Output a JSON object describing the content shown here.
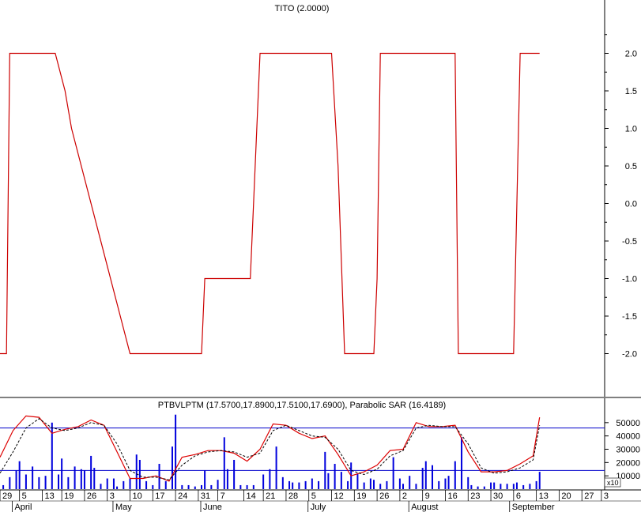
{
  "chart_data": [
    {
      "type": "line",
      "title": "TITO (2.0000)",
      "ylim": [
        -2.5,
        2.5
      ],
      "yticks": [
        "2.0",
        "1.5",
        "1.0",
        "0.5",
        "0.0",
        "-0.5",
        "-1.0",
        "-1.5",
        "-2.0"
      ],
      "ytick_values": [
        2.0,
        1.5,
        1.0,
        0.5,
        0.0,
        -0.5,
        -1.0,
        -1.5,
        -2.0
      ],
      "grid": false,
      "line_color": "#cc0000",
      "series": [
        {
          "x": [
            0,
            2,
            3,
            17,
            20,
            22,
            40,
            42,
            43,
            44,
            60,
            62,
            63,
            64,
            76,
            77,
            80,
            82,
            83,
            101,
            102,
            104,
            106,
            107,
            113,
            115,
            116,
            117,
            128,
            129,
            130,
            131,
            140,
            141,
            142,
            143,
            157,
            158,
            160,
            161,
            162,
            166
          ],
          "values": [
            -2.0,
            -2.0,
            2.0,
            2.0,
            1.5,
            1.0,
            -2.0,
            -2.0,
            -2.0,
            -2.0,
            -2.0,
            -2.0,
            -1.0,
            -1.0,
            -1.0,
            -1.0,
            2.0,
            2.0,
            2.0,
            2.0,
            2.0,
            0.5,
            -2.0,
            -2.0,
            -2.0,
            -2.0,
            -1.0,
            2.0,
            2.0,
            2.0,
            2.0,
            2.0,
            2.0,
            -2.0,
            -2.0,
            -2.0,
            -2.0,
            -2.0,
            2.0,
            2.0,
            2.0,
            2.0
          ]
        }
      ]
    },
    {
      "type": "line",
      "title": "PTBVLPTM (17.5700,17.8900,17.5100,17.6900), Parabolic SAR (16.4189)",
      "ylim": [
        0,
        60000
      ],
      "yticks": [
        "50000",
        "40000",
        "30000",
        "20000",
        "10000"
      ],
      "ytick_values": [
        50000,
        40000,
        30000,
        20000,
        10000
      ],
      "scale_label": "x10",
      "reference_lines": [
        46000,
        14000
      ],
      "grid": false,
      "series": [
        {
          "style": "solid-red",
          "x": [
            0,
            4,
            8,
            12,
            16,
            20,
            24,
            28,
            32,
            36,
            40,
            44,
            48,
            52,
            56,
            60,
            64,
            68,
            72,
            76,
            80,
            84,
            88,
            92,
            96,
            100,
            104,
            108,
            112,
            116,
            120,
            124,
            128,
            132,
            136,
            140,
            144,
            148,
            152,
            156,
            160,
            164,
            166
          ],
          "values": [
            24000,
            44000,
            55000,
            54000,
            42000,
            45000,
            47000,
            52000,
            48000,
            28000,
            8000,
            8000,
            10000,
            6000,
            24000,
            26000,
            29000,
            29000,
            27000,
            21000,
            30000,
            49000,
            48000,
            42000,
            38000,
            40000,
            26000,
            10000,
            13000,
            18000,
            29000,
            30000,
            50000,
            47000,
            47000,
            48000,
            28000,
            13000,
            13000,
            14000,
            19000,
            25000,
            54000
          ]
        },
        {
          "style": "dashed-black",
          "x": [
            0,
            4,
            8,
            12,
            16,
            20,
            24,
            28,
            32,
            36,
            40,
            44,
            48,
            52,
            56,
            60,
            64,
            68,
            72,
            76,
            80,
            84,
            88,
            92,
            96,
            100,
            104,
            108,
            112,
            116,
            120,
            124,
            128,
            132,
            136,
            140,
            144,
            148,
            152,
            156,
            160,
            164,
            166
          ],
          "values": [
            12000,
            28000,
            46000,
            53000,
            46000,
            44000,
            46000,
            50000,
            48000,
            34000,
            14000,
            9000,
            9000,
            7000,
            18000,
            25000,
            28000,
            29000,
            28000,
            24000,
            27000,
            44000,
            48000,
            44000,
            40000,
            39000,
            30000,
            14000,
            11000,
            15000,
            25000,
            29000,
            46000,
            48000,
            47000,
            47000,
            34000,
            16000,
            12000,
            13000,
            16000,
            22000,
            48000
          ]
        }
      ],
      "bars": [
        {
          "x": 1,
          "value": 3000
        },
        {
          "x": 3,
          "value": 9000
        },
        {
          "x": 5,
          "value": 14000
        },
        {
          "x": 6,
          "value": 21000
        },
        {
          "x": 8,
          "value": 11000
        },
        {
          "x": 10,
          "value": 17000
        },
        {
          "x": 12,
          "value": 9000
        },
        {
          "x": 14,
          "value": 10000
        },
        {
          "x": 16,
          "value": 50000
        },
        {
          "x": 18,
          "value": 11000
        },
        {
          "x": 19,
          "value": 23000
        },
        {
          "x": 21,
          "value": 9000
        },
        {
          "x": 23,
          "value": 17000
        },
        {
          "x": 25,
          "value": 15000
        },
        {
          "x": 26,
          "value": 14000
        },
        {
          "x": 28,
          "value": 25000
        },
        {
          "x": 29,
          "value": 16000
        },
        {
          "x": 31,
          "value": 4000
        },
        {
          "x": 33,
          "value": 8000
        },
        {
          "x": 35,
          "value": 8000
        },
        {
          "x": 36,
          "value": 2000
        },
        {
          "x": 38,
          "value": 6000
        },
        {
          "x": 40,
          "value": 8000
        },
        {
          "x": 42,
          "value": 26000
        },
        {
          "x": 43,
          "value": 22000
        },
        {
          "x": 45,
          "value": 6000
        },
        {
          "x": 47,
          "value": 3000
        },
        {
          "x": 49,
          "value": 19000
        },
        {
          "x": 51,
          "value": 6000
        },
        {
          "x": 53,
          "value": 32000
        },
        {
          "x": 54,
          "value": 56000
        },
        {
          "x": 56,
          "value": 3000
        },
        {
          "x": 58,
          "value": 3000
        },
        {
          "x": 60,
          "value": 2000
        },
        {
          "x": 62,
          "value": 3000
        },
        {
          "x": 63,
          "value": 14000
        },
        {
          "x": 65,
          "value": 3000
        },
        {
          "x": 67,
          "value": 7000
        },
        {
          "x": 69,
          "value": 39000
        },
        {
          "x": 70,
          "value": 15000
        },
        {
          "x": 72,
          "value": 22000
        },
        {
          "x": 74,
          "value": 3000
        },
        {
          "x": 76,
          "value": 3000
        },
        {
          "x": 78,
          "value": 3000
        },
        {
          "x": 81,
          "value": 11000
        },
        {
          "x": 83,
          "value": 15000
        },
        {
          "x": 85,
          "value": 32000
        },
        {
          "x": 87,
          "value": 9000
        },
        {
          "x": 89,
          "value": 6000
        },
        {
          "x": 90,
          "value": 5000
        },
        {
          "x": 92,
          "value": 5000
        },
        {
          "x": 94,
          "value": 6000
        },
        {
          "x": 96,
          "value": 8000
        },
        {
          "x": 98,
          "value": 6000
        },
        {
          "x": 100,
          "value": 28000
        },
        {
          "x": 101,
          "value": 12000
        },
        {
          "x": 103,
          "value": 19000
        },
        {
          "x": 105,
          "value": 13000
        },
        {
          "x": 107,
          "value": 6000
        },
        {
          "x": 108,
          "value": 20000
        },
        {
          "x": 110,
          "value": 12000
        },
        {
          "x": 112,
          "value": 5000
        },
        {
          "x": 114,
          "value": 8000
        },
        {
          "x": 115,
          "value": 7000
        },
        {
          "x": 117,
          "value": 4000
        },
        {
          "x": 119,
          "value": 6000
        },
        {
          "x": 121,
          "value": 24000
        },
        {
          "x": 123,
          "value": 8000
        },
        {
          "x": 124,
          "value": 4000
        },
        {
          "x": 126,
          "value": 10000
        },
        {
          "x": 128,
          "value": 4000
        },
        {
          "x": 130,
          "value": 16000
        },
        {
          "x": 131,
          "value": 21000
        },
        {
          "x": 133,
          "value": 18000
        },
        {
          "x": 135,
          "value": 6000
        },
        {
          "x": 137,
          "value": 8000
        },
        {
          "x": 138,
          "value": 10000
        },
        {
          "x": 140,
          "value": 21000
        },
        {
          "x": 142,
          "value": 39000
        },
        {
          "x": 144,
          "value": 9000
        },
        {
          "x": 145,
          "value": 3000
        },
        {
          "x": 147,
          "value": 2000
        },
        {
          "x": 149,
          "value": 2000
        },
        {
          "x": 151,
          "value": 5000
        },
        {
          "x": 152,
          "value": 5000
        },
        {
          "x": 154,
          "value": 4000
        },
        {
          "x": 156,
          "value": 4000
        },
        {
          "x": 158,
          "value": 4000
        },
        {
          "x": 159,
          "value": 5000
        },
        {
          "x": 161,
          "value": 3000
        },
        {
          "x": 163,
          "value": 4000
        },
        {
          "x": 165,
          "value": 6000
        },
        {
          "x": 166,
          "value": 13000
        }
      ]
    }
  ],
  "x_axis": {
    "x_max": 186,
    "day_ticks": [
      {
        "x": 0,
        "label": "29"
      },
      {
        "x": 6,
        "label": "5"
      },
      {
        "x": 13,
        "label": "13"
      },
      {
        "x": 19,
        "label": "19"
      },
      {
        "x": 26,
        "label": "26"
      },
      {
        "x": 33,
        "label": "3"
      },
      {
        "x": 40,
        "label": "10"
      },
      {
        "x": 47,
        "label": "17"
      },
      {
        "x": 54,
        "label": "24"
      },
      {
        "x": 61,
        "label": "31"
      },
      {
        "x": 67,
        "label": "7"
      },
      {
        "x": 75,
        "label": "14"
      },
      {
        "x": 81,
        "label": "21"
      },
      {
        "x": 88,
        "label": "28"
      },
      {
        "x": 95,
        "label": "5"
      },
      {
        "x": 102,
        "label": "12"
      },
      {
        "x": 109,
        "label": "19"
      },
      {
        "x": 116,
        "label": "26"
      },
      {
        "x": 123,
        "label": "2"
      },
      {
        "x": 130,
        "label": "9"
      },
      {
        "x": 137,
        "label": "16"
      },
      {
        "x": 144,
        "label": "23"
      },
      {
        "x": 151,
        "label": "30"
      },
      {
        "x": 158,
        "label": "6"
      },
      {
        "x": 165,
        "label": "13"
      },
      {
        "x": 172,
        "label": "20"
      },
      {
        "x": 179,
        "label": "27"
      },
      {
        "x": 185,
        "label": "3"
      }
    ],
    "months": [
      {
        "x": 4,
        "label": "April"
      },
      {
        "x": 35,
        "label": "May"
      },
      {
        "x": 62,
        "label": "June"
      },
      {
        "x": 95,
        "label": "July"
      },
      {
        "x": 126,
        "label": "August"
      },
      {
        "x": 157,
        "label": "September"
      }
    ]
  }
}
